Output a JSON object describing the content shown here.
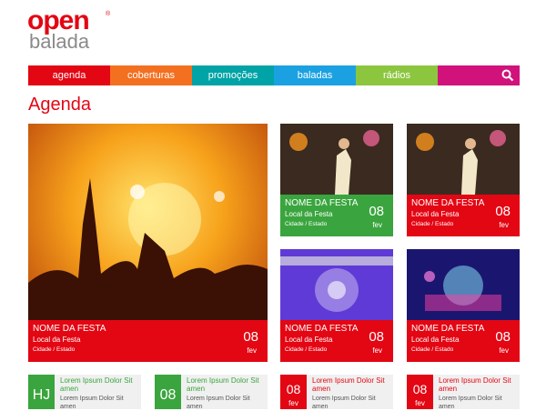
{
  "logo": {
    "line1": "open",
    "line2": "balada",
    "mark": "®"
  },
  "nav": [
    {
      "label": "agenda",
      "color": "#e30613"
    },
    {
      "label": "coberturas",
      "color": "#f37021"
    },
    {
      "label": "promoções",
      "color": "#00a3a6"
    },
    {
      "label": "baladas",
      "color": "#1ba1e2"
    },
    {
      "label": "rádios",
      "color": "#8cc63f"
    }
  ],
  "search": {
    "icon": "search-icon",
    "color": "#d1127b"
  },
  "heading": "Agenda",
  "featured": {
    "title": "NOME DA FESTA",
    "place": "Local da Festa",
    "city": "Cidade / Estado",
    "day": "08",
    "month": "fev",
    "color": "#e30613"
  },
  "events": [
    {
      "title": "NOME DA FESTA",
      "place": "Local da Festa",
      "city": "Cidade / Estado",
      "day": "08",
      "month": "fev",
      "color": "#3aa53e"
    },
    {
      "title": "NOME DA FESTA",
      "place": "Local da Festa",
      "city": "Cidade / Estado",
      "day": "08",
      "month": "fev",
      "color": "#e30613"
    },
    {
      "title": "NOME DA FESTA",
      "place": "Local da Festa",
      "city": "Cidade / Estado",
      "day": "08",
      "month": "fev",
      "color": "#e30613"
    },
    {
      "title": "NOME DA FESTA",
      "place": "Local da Festa",
      "city": "Cidade / Estado",
      "day": "08",
      "month": "fev",
      "color": "#e30613"
    }
  ],
  "mini": [
    {
      "day": "HJ",
      "month": "",
      "title": "Lorem Ipsum Dolor Sit amen",
      "text": "Lorem Ipsum Dolor Sit amen",
      "color": "#3aa53e",
      "titleColor": "#3aa53e"
    },
    {
      "day": "08",
      "month": "",
      "title": "Lorem Ipsum Dolor Sit amen",
      "text": "Lorem Ipsum Dolor Sit amen",
      "color": "#3aa53e",
      "titleColor": "#3aa53e"
    },
    {
      "day": "08",
      "month": "fev",
      "title": "Lorem Ipsum Dolor Sit amen",
      "text": "Lorem Ipsum Dolor Sit amen",
      "color": "#e30613",
      "titleColor": "#e30613"
    },
    {
      "day": "08",
      "month": "fev",
      "title": "Lorem Ipsum Dolor Sit amen",
      "text": "Lorem Ipsum Dolor Sit amen",
      "color": "#e30613",
      "titleColor": "#e30613"
    }
  ]
}
